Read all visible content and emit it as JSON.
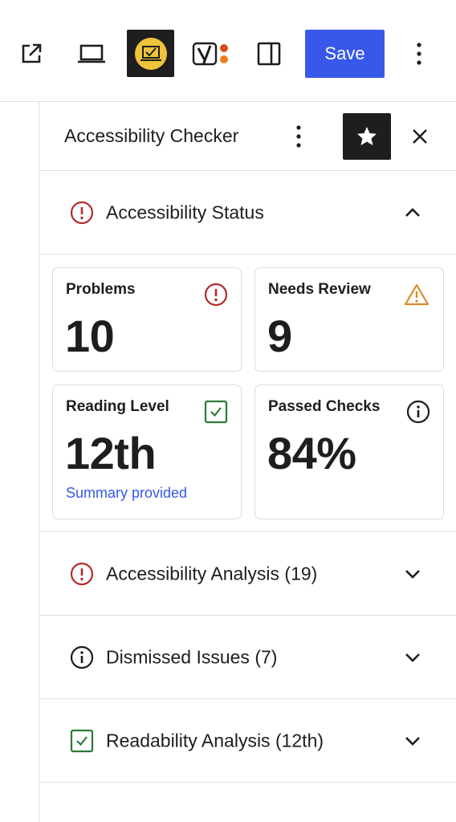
{
  "toolbar": {
    "save_label": "Save",
    "icons": [
      "external-link-icon",
      "laptop-icon",
      "accessibility-checker-icon",
      "yoast-seo-icon",
      "sidebar-toggle-icon",
      "more-vertical-icon"
    ]
  },
  "sidebar": {
    "title": "Accessibility Checker",
    "icons": [
      "more-vertical-icon",
      "star-icon",
      "close-icon"
    ]
  },
  "status_panel": {
    "label": "Accessibility Status",
    "expanded": true,
    "cards": {
      "problems": {
        "label": "Problems",
        "value": "10",
        "icon": "error-circle-icon"
      },
      "needs_review": {
        "label": "Needs Review",
        "value": "9",
        "icon": "warning-triangle-icon"
      },
      "reading_level": {
        "label": "Reading Level",
        "value": "12th",
        "sub": "Summary provided",
        "icon": "check-square-icon"
      },
      "passed_checks": {
        "label": "Passed Checks",
        "value": "84%",
        "icon": "info-circle-icon"
      }
    }
  },
  "panels": {
    "analysis": {
      "label": "Accessibility Analysis (19)",
      "icon": "error-circle-icon"
    },
    "dismissed": {
      "label": "Dismissed Issues (7)",
      "icon": "info-circle-icon"
    },
    "readability": {
      "label": "Readability Analysis (12th)",
      "icon": "check-square-icon"
    }
  },
  "colors": {
    "accent": "#3858e9",
    "error": "#b32d2e",
    "warning": "#d98c2b",
    "success": "#2c7a3a",
    "dark": "#1e1e1e",
    "a11y_badge": "#f0c33c"
  }
}
